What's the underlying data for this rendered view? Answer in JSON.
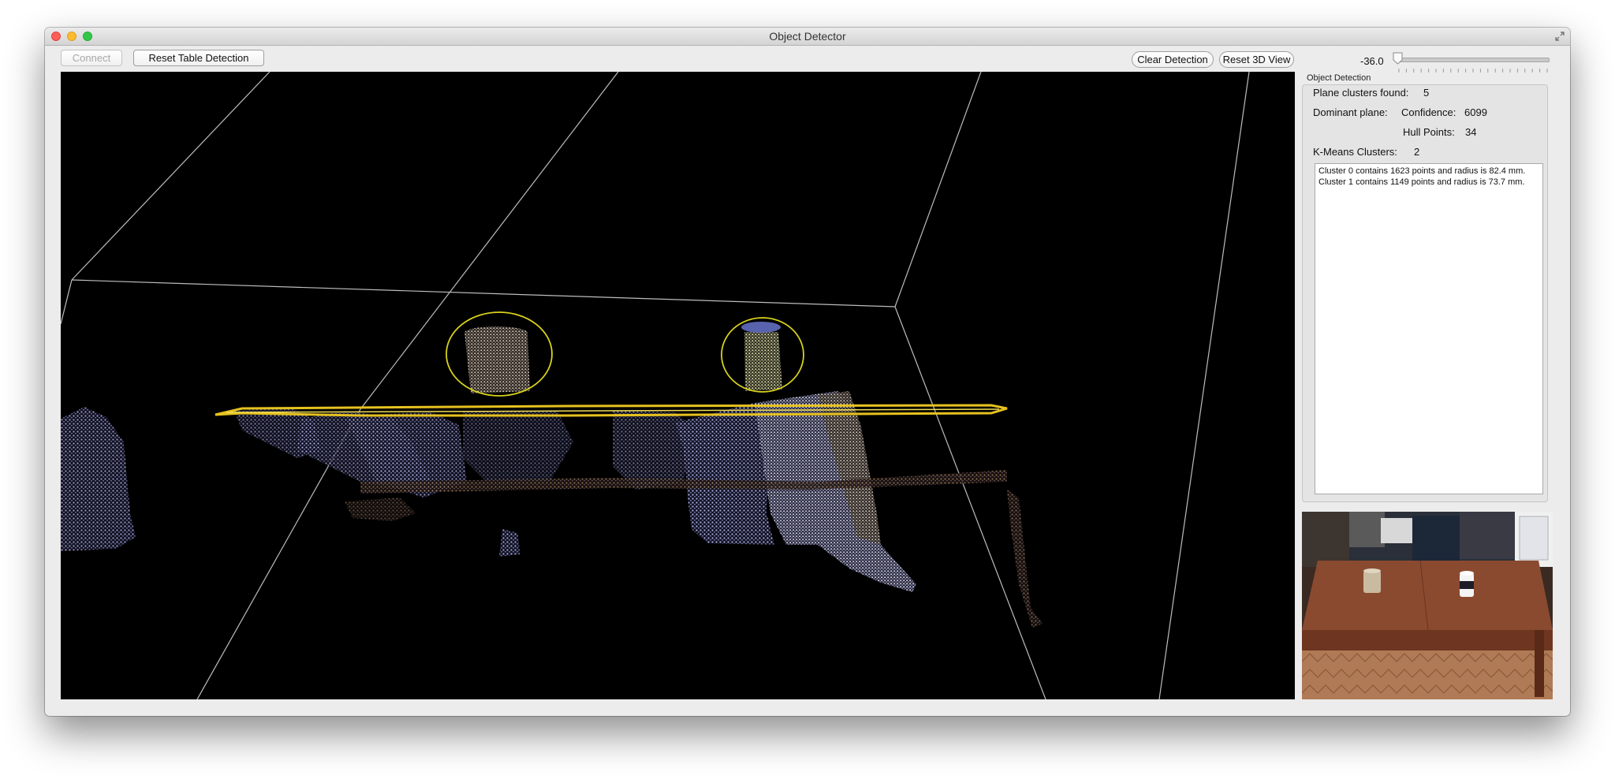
{
  "window": {
    "title": "Object Detector"
  },
  "toolbar": {
    "connect_label": "Connect",
    "reset_table_label": "Reset Table Detection",
    "clear_detection_label": "Clear Detection",
    "reset_3d_label": "Reset 3D View"
  },
  "slider": {
    "value_text": "-36.0"
  },
  "detection": {
    "group_title": "Object Detection",
    "plane_clusters_label": "Plane clusters found:",
    "plane_clusters_value": "5",
    "dominant_plane_label": "Dominant plane:",
    "confidence_label": "Confidence:",
    "confidence_value": "6099",
    "hull_points_label": "Hull Points:",
    "hull_points_value": "34",
    "kmeans_label": "K-Means Clusters:",
    "kmeans_value": "2",
    "results": [
      "Cluster 0 contains 1623 points and radius is 82.4 mm.",
      "Cluster 1 contains 1149 points and radius is 73.7 mm."
    ]
  },
  "colors": {
    "viewport_bg": "#000000",
    "table_plane": "#e6c21f",
    "cluster_ring": "#d8d21c",
    "point_cloud": "#b4b8e6"
  },
  "icons": [
    "close-icon",
    "minimize-icon",
    "zoom-icon",
    "fullscreen-icon"
  ]
}
